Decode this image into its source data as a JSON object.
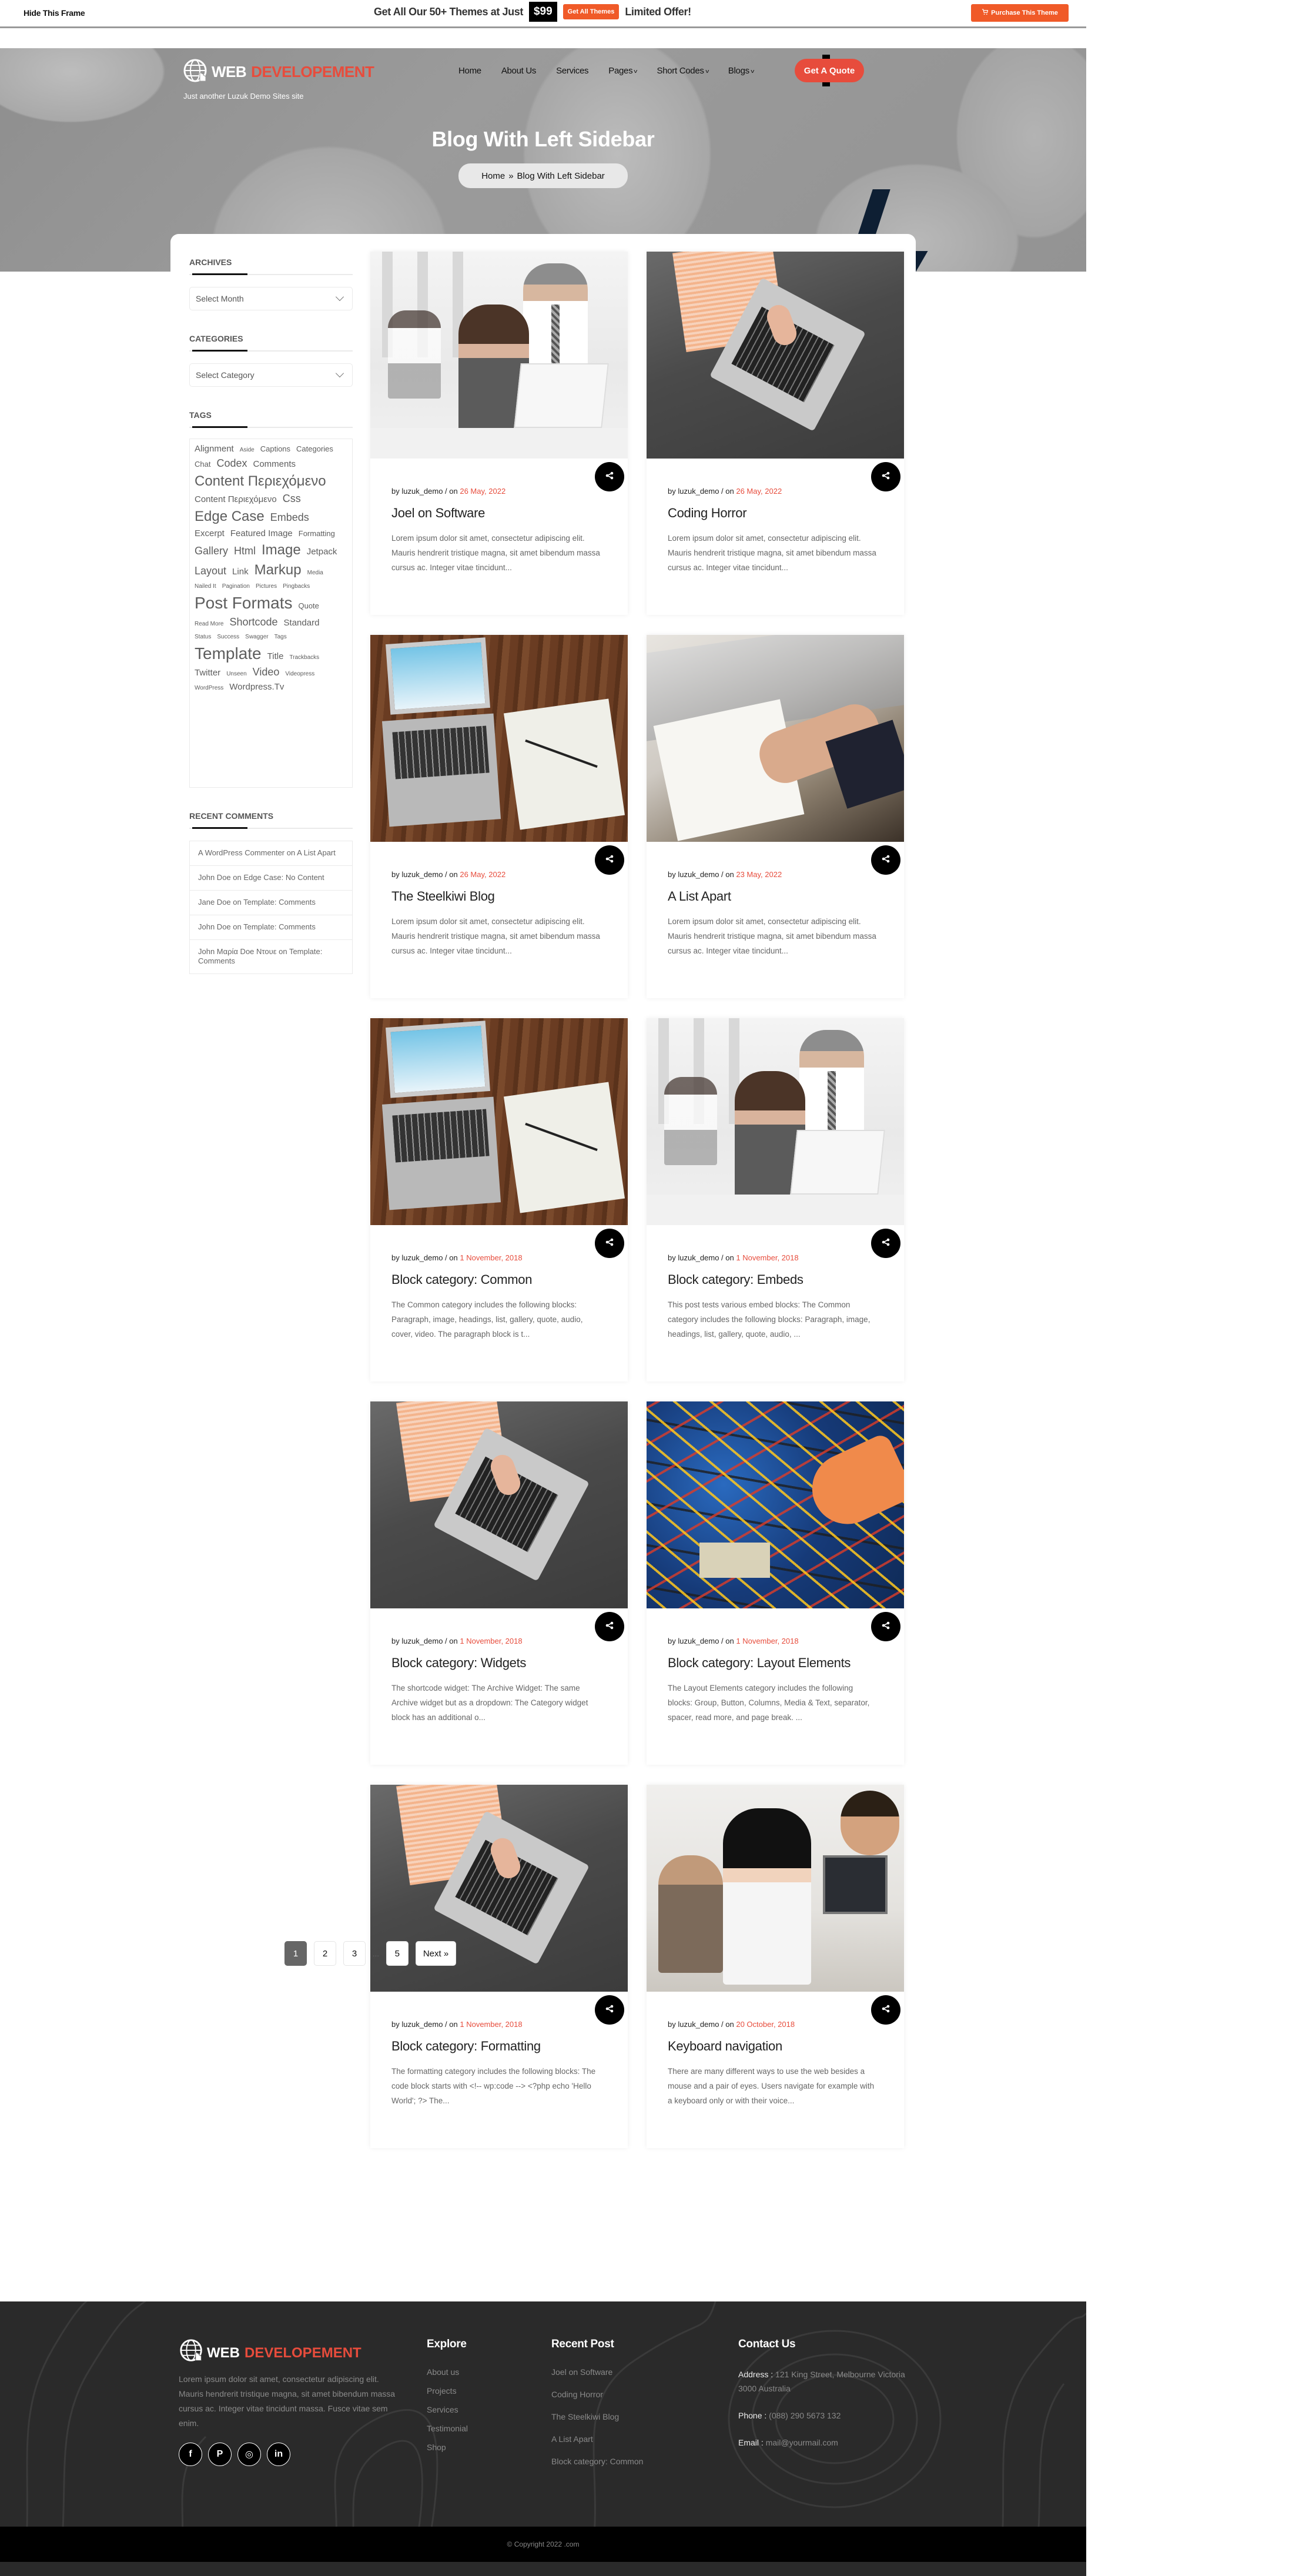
{
  "promo": {
    "hide_frame": "Hide This Frame",
    "headline": "Get All Our 50+ Themes at Just",
    "price": "$99",
    "get_all_label": "Get All Themes",
    "limited": "Limited Offer!",
    "purchase_label": "Purchase This Theme",
    "accent_color": "#f05a28"
  },
  "header": {
    "logo_word1": "WEB",
    "logo_word2": "DEVELOPEMENT",
    "tagline": "Just another Luzuk Demo Sites site",
    "nav": [
      {
        "label": "Home",
        "has_dropdown": false
      },
      {
        "label": "About Us",
        "has_dropdown": false
      },
      {
        "label": "Services",
        "has_dropdown": false
      },
      {
        "label": "Pages",
        "has_dropdown": true
      },
      {
        "label": "Short Codes",
        "has_dropdown": true
      },
      {
        "label": "Blogs",
        "has_dropdown": true
      }
    ],
    "cta_label": "Get A Quote",
    "brand_color": "#e74c3c"
  },
  "hero": {
    "title": "Blog With Left Sidebar",
    "breadcrumb": [
      "Home",
      "Blog With Left Sidebar"
    ],
    "breadcrumb_sep": "»"
  },
  "sidebar": {
    "archives": {
      "title": "ARCHIVES",
      "placeholder": "Select Month"
    },
    "categories": {
      "title": "CATEGORIES",
      "placeholder": "Select Category"
    },
    "tags": {
      "title": "TAGS",
      "items": [
        {
          "label": "Alignment",
          "size": "m"
        },
        {
          "label": "Aside",
          "size": "xs"
        },
        {
          "label": "Captions",
          "size": "s"
        },
        {
          "label": "Categories",
          "size": "s"
        },
        {
          "label": "Chat",
          "size": "s"
        },
        {
          "label": "Codex",
          "size": "l"
        },
        {
          "label": "Comments",
          "size": "m"
        },
        {
          "label": "Content Περιεχόμενο",
          "size": "xl"
        },
        {
          "label": "Content Περιεχόμενο",
          "size": "m"
        },
        {
          "label": "Css",
          "size": "l"
        },
        {
          "label": "Edge Case",
          "size": "xl"
        },
        {
          "label": "Embeds",
          "size": "l"
        },
        {
          "label": "Excerpt",
          "size": "m"
        },
        {
          "label": "Featured Image",
          "size": "m"
        },
        {
          "label": "Formatting",
          "size": "s"
        },
        {
          "label": "Gallery",
          "size": "l"
        },
        {
          "label": "Html",
          "size": "l"
        },
        {
          "label": "Image",
          "size": "xl"
        },
        {
          "label": "Jetpack",
          "size": "m"
        },
        {
          "label": "Layout",
          "size": "l"
        },
        {
          "label": "Link",
          "size": "m"
        },
        {
          "label": "Markup",
          "size": "xl"
        },
        {
          "label": "Media",
          "size": "xs"
        },
        {
          "label": "Nailed It",
          "size": "xs"
        },
        {
          "label": "Pagination",
          "size": "xs"
        },
        {
          "label": "Pictures",
          "size": "xs"
        },
        {
          "label": "Pingbacks",
          "size": "xs"
        },
        {
          "label": "Post Formats",
          "size": "xxl"
        },
        {
          "label": "Quote",
          "size": "s"
        },
        {
          "label": "Read More",
          "size": "xs"
        },
        {
          "label": "Shortcode",
          "size": "l"
        },
        {
          "label": "Standard",
          "size": "m"
        },
        {
          "label": "Status",
          "size": "xs"
        },
        {
          "label": "Success",
          "size": "xs"
        },
        {
          "label": "Swagger",
          "size": "xs"
        },
        {
          "label": "Tags",
          "size": "xs"
        },
        {
          "label": "Template",
          "size": "xxl"
        },
        {
          "label": "Title",
          "size": "m"
        },
        {
          "label": "Trackbacks",
          "size": "xs"
        },
        {
          "label": "Twitter",
          "size": "m"
        },
        {
          "label": "Unseen",
          "size": "xs"
        },
        {
          "label": "Video",
          "size": "l"
        },
        {
          "label": "Videopress",
          "size": "xs"
        },
        {
          "label": "WordPress",
          "size": "xs"
        },
        {
          "label": "Wordpress.Tv",
          "size": "m"
        }
      ]
    },
    "recent_comments": {
      "title": "RECENT COMMENTS",
      "items": [
        "A WordPress Commenter on A List Apart",
        "John Doe on Edge Case: No Content",
        "Jane Doe on Template: Comments",
        "John Doe on Template: Comments",
        "John Μαρία Doe Ντουε on Template: Comments"
      ]
    }
  },
  "posts": [
    {
      "author": "by luzuk_demo / on",
      "date": "26 May, 2022",
      "title": "Joel on Software",
      "excerpt": "Lorem ipsum dolor sit amet, consectetur adipiscing elit. Mauris hendrerit tristique magna, sit amet bibendum massa cursus ac. Integer vitae tincidunt...",
      "image": "office-team"
    },
    {
      "author": "by luzuk_demo / on",
      "date": "26 May, 2022",
      "title": "Coding Horror",
      "excerpt": "Lorem ipsum dolor sit amet, consectetur adipiscing elit. Mauris hendrerit tristique magna, sit amet bibendum massa cursus ac. Integer vitae tincidunt...",
      "image": "laptop-lap"
    },
    {
      "author": "by luzuk_demo / on",
      "date": "26 May, 2022",
      "title": "The Steelkiwi Blog",
      "excerpt": "Lorem ipsum dolor sit amet, consectetur adipiscing elit. Mauris hendrerit tristique magna, sit amet bibendum massa cursus ac. Integer vitae tincidunt...",
      "image": "laptop-wood"
    },
    {
      "author": "by luzuk_demo / on",
      "date": "23 May, 2022",
      "title": "A List Apart",
      "excerpt": "Lorem ipsum dolor sit amet, consectetur adipiscing elit. Mauris hendrerit tristique magna, sit amet bibendum massa cursus ac. Integer vitae tincidunt...",
      "image": "notebook-writing"
    },
    {
      "author": "by luzuk_demo / on",
      "date": "1 November, 2018",
      "title": "Block category: Common",
      "excerpt": "The Common category includes the following blocks: Paragraph, image, headings, list, gallery, quote, audio, cover, video. The paragraph block is t...",
      "image": "laptop-wood"
    },
    {
      "author": "by luzuk_demo / on",
      "date": "1 November, 2018",
      "title": "Block category: Embeds",
      "excerpt": "This post tests various embed blocks: The Common category includes the following blocks: Paragraph, image, headings, list, gallery, quote, audio, ...",
      "image": "office-team"
    },
    {
      "author": "by luzuk_demo / on",
      "date": "1 November, 2018",
      "title": "Block category: Widgets",
      "excerpt": "The shortcode widget: The Archive Widget: The same Archive widget but as a dropdown: The Category widget block has an additional o...",
      "image": "laptop-lap"
    },
    {
      "author": "by luzuk_demo / on",
      "date": "1 November, 2018",
      "title": "Block category: Layout Elements",
      "excerpt": "The Layout Elements category includes the following blocks: Group, Button, Columns, Media & Text, separator, spacer, read more, and page break. ...",
      "image": "circuit-board"
    },
    {
      "author": "by luzuk_demo / on",
      "date": "1 November, 2018",
      "title": "Block category: Formatting",
      "excerpt": "The formatting category includes the following blocks: The code block starts with <!-- wp:code --> <?php echo 'Hello World'; ?> The...",
      "image": "laptop-lap"
    },
    {
      "author": "by luzuk_demo / on",
      "date": "20 October, 2018",
      "title": "Keyboard navigation",
      "excerpt": "There are many different ways to use the web besides a mouse and a pair of eyes. Users navigate for example with a keyboard only or with their voice...",
      "image": "office-desk"
    }
  ],
  "pagination": {
    "pages": [
      "1",
      "2",
      "3"
    ],
    "dots": "...",
    "last": "5",
    "next": "Next »",
    "current": "1"
  },
  "footer": {
    "about": "Lorem ipsum dolor sit amet, consectetur adipiscing elit. Mauris hendrerit tristique magna, sit amet bibendum massa cursus ac. Integer vitae tincidunt massa. Fusce vitae sem enim.",
    "socials": [
      {
        "name": "facebook",
        "glyph": "f"
      },
      {
        "name": "pinterest",
        "glyph": "P"
      },
      {
        "name": "instagram",
        "glyph": "◎"
      },
      {
        "name": "linkedin",
        "glyph": "in"
      }
    ],
    "explore": {
      "title": "Explore",
      "links": [
        "About us",
        "Projects",
        "Services",
        "Testimonial",
        "Shop"
      ]
    },
    "recent": {
      "title": "Recent Post",
      "links": [
        "Joel on Software",
        "Coding Horror",
        "The Steelkiwi Blog",
        "A List Apart",
        "Block category: Common"
      ]
    },
    "contact": {
      "title": "Contact Us",
      "address_label": "Address :",
      "address": "121 King Street, Melbourne Victoria 3000 Australia",
      "phone_label": "Phone :",
      "phone": "(088) 290 5673 132",
      "email_label": "Email :",
      "email": "mail@yourmail.com"
    },
    "copyright": "© Copyright 2022 .com"
  }
}
